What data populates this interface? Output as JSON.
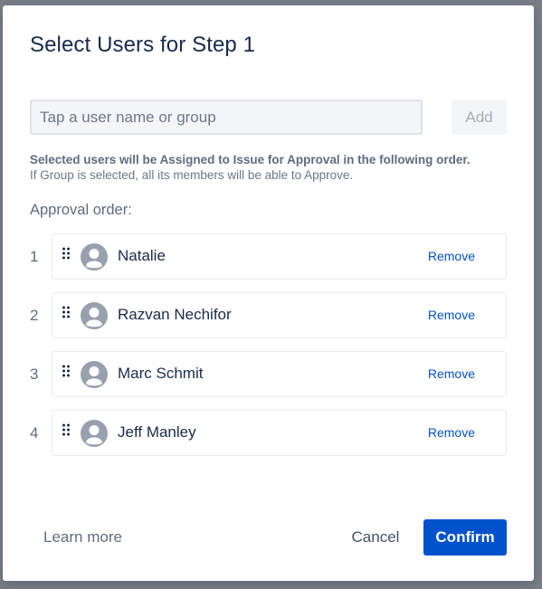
{
  "dialog": {
    "title": "Select Users for Step 1"
  },
  "search": {
    "placeholder": "Tap a user name or group",
    "value": "",
    "add_label": "Add"
  },
  "info": {
    "line1": "Selected users will be Assigned to Issue for Approval in the following order.",
    "line2": "If Group is selected, all its members will be able to Approve."
  },
  "approval": {
    "label": "Approval order:",
    "users": [
      {
        "order": "1",
        "name": "Natalie",
        "remove_label": "Remove"
      },
      {
        "order": "2",
        "name": "Razvan Nechifor",
        "remove_label": "Remove"
      },
      {
        "order": "3",
        "name": "Marc Schmit",
        "remove_label": "Remove"
      },
      {
        "order": "4",
        "name": "Jeff Manley",
        "remove_label": "Remove"
      }
    ]
  },
  "footer": {
    "learn_more": "Learn more",
    "cancel": "Cancel",
    "confirm": "Confirm"
  },
  "icons": {
    "drag": "drag-handle-icon",
    "avatar": "user-avatar-icon"
  },
  "colors": {
    "primary": "#0052cc",
    "text": "#172b4d",
    "subtle": "#5e6c84",
    "border": "#ebecf0"
  }
}
